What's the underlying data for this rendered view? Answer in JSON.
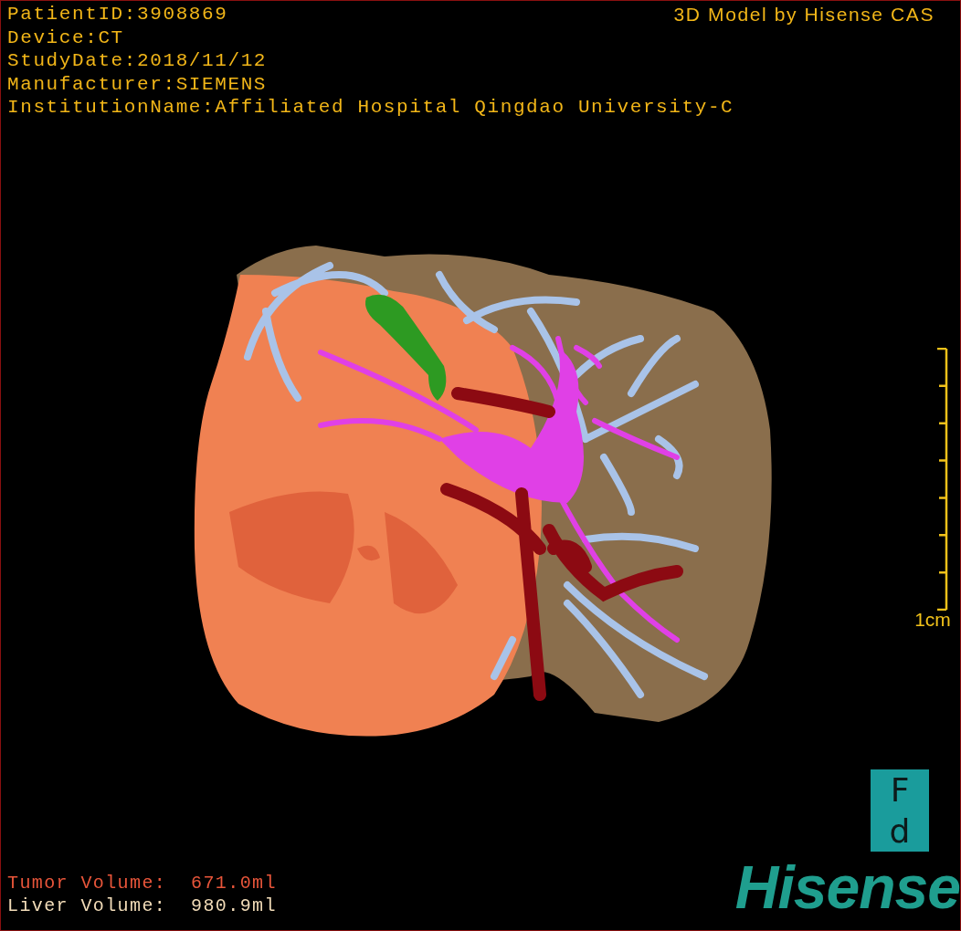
{
  "study_info": [
    "PatientID:3908869",
    "Device:CT",
    "StudyDate:2018/11/12",
    "Manufacturer:SIEMENS",
    "InstitutionName:Affiliated Hospital Qingdao University-C"
  ],
  "viewer_title": "3D Model by Hisense CAS",
  "scale_bar": {
    "label": "1cm"
  },
  "volumes": [
    {
      "label": "Tumor Volume:",
      "value": "671.0ml",
      "color": "#e8553a"
    },
    {
      "label": "Liver Volume:",
      "value": "980.9ml",
      "color": "#f2dcb8"
    }
  ],
  "orientation_marker": {
    "top": "F",
    "bottom": "d"
  },
  "logo": "Hisense"
}
